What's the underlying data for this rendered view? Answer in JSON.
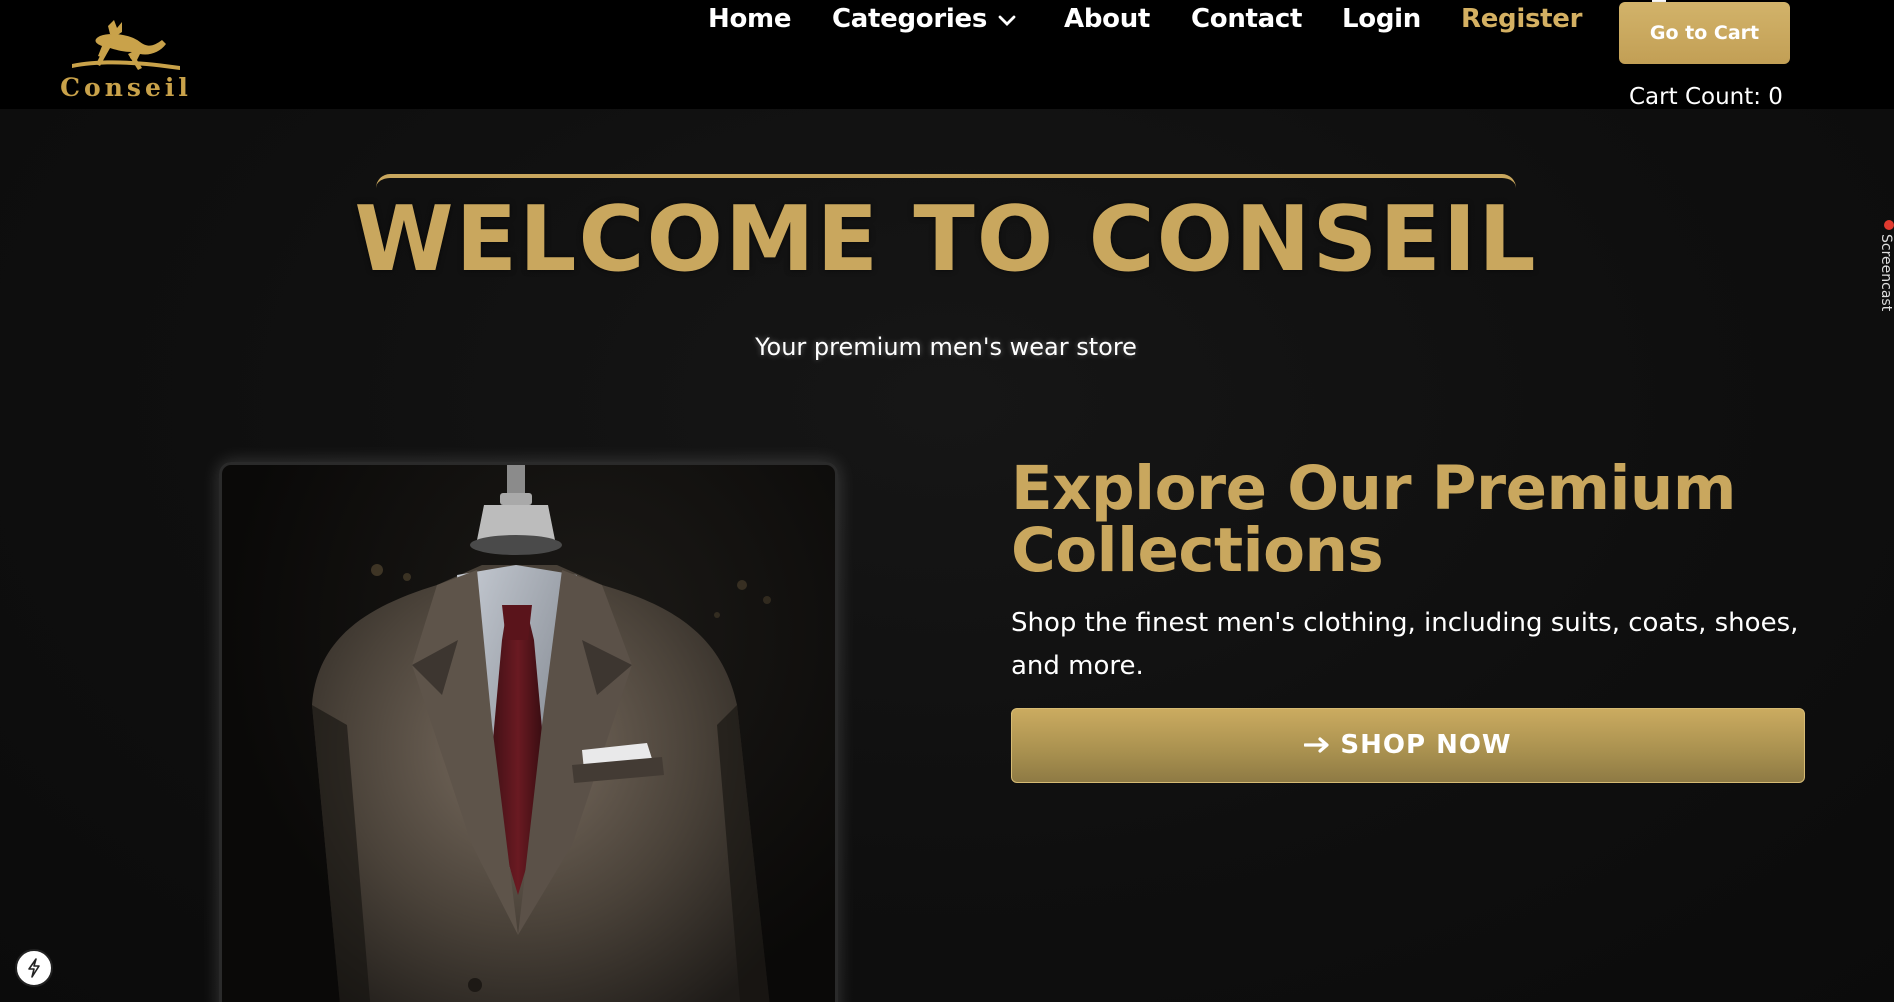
{
  "brand": {
    "name": "Conseil",
    "logo_icon": "leaping-stag-logo",
    "colors": {
      "gold": "#c9a75e",
      "register": "#d4b062",
      "background": "#0f0f0f",
      "nav_bg": "#000000"
    }
  },
  "nav": {
    "items": [
      {
        "label": "Home"
      },
      {
        "label": "Categories",
        "icon": "chevron-down-icon"
      },
      {
        "label": "About"
      },
      {
        "label": "Contact"
      },
      {
        "label": "Login"
      },
      {
        "label": "Register"
      }
    ],
    "cart_button_label": "Go to Cart",
    "cart_count_label": "Cart Count: 0"
  },
  "hero": {
    "title": "WELCOME TO CONSEIL",
    "subtitle": "Your premium men's wear store",
    "image_subject": "suit-on-mannequin"
  },
  "collection": {
    "heading_line1": "Explore Our Premium",
    "heading_line2": "Collections",
    "description": "Shop the finest men's clothing, including suits, coats, shoes, and more.",
    "button_icon": "arrow-right-icon",
    "button_label": "SHOP NOW"
  },
  "widgets": {
    "side_tab_label": "Screencast",
    "floating_button_icon": "lightning-bolt-icon"
  }
}
